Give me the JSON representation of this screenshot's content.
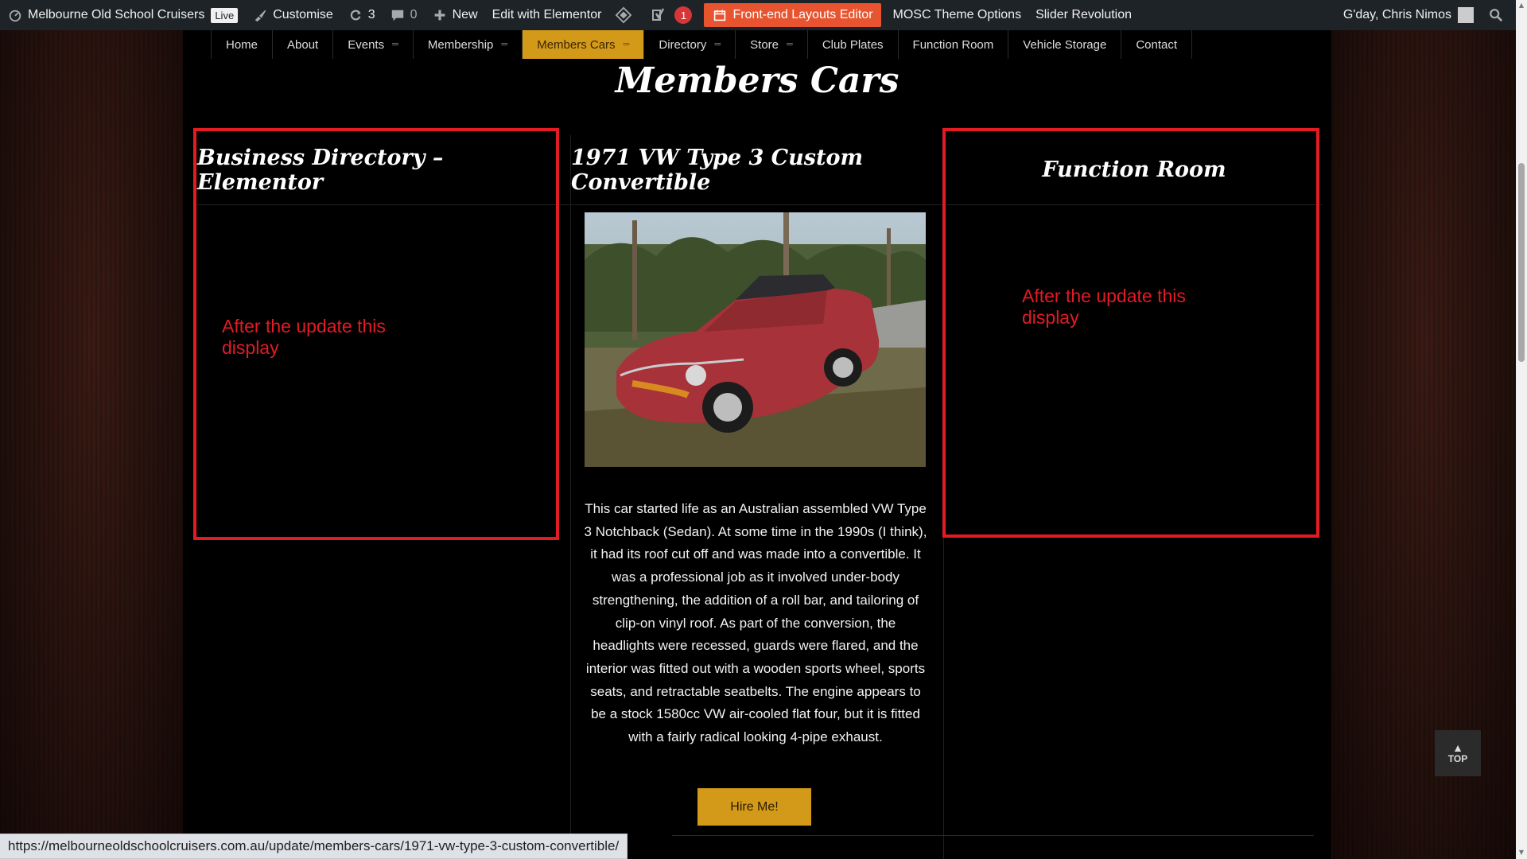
{
  "adminbar": {
    "site_name": "Melbourne Old School Cruisers",
    "live": "Live",
    "customise": "Customise",
    "updates_count": "3",
    "comments_count": "0",
    "new": "New",
    "edit_elementor": "Edit with Elementor",
    "yoast_count": "1",
    "frontend_editor": "Front-end Layouts Editor",
    "theme_options": "MOSC Theme Options",
    "slider_revolution": "Slider Revolution",
    "greeting": "G'day, Chris Nimos"
  },
  "nav": {
    "items": [
      {
        "label": "Home"
      },
      {
        "label": "About"
      },
      {
        "label": "Events"
      },
      {
        "label": "Membership"
      },
      {
        "label": "Members Cars"
      },
      {
        "label": "Directory"
      },
      {
        "label": "Store"
      },
      {
        "label": "Club Plates"
      },
      {
        "label": "Function Room"
      },
      {
        "label": "Vehicle Storage"
      },
      {
        "label": "Contact"
      }
    ]
  },
  "page": {
    "title": "Members Cars"
  },
  "columns": {
    "left_title": "Business Directory – Elementor",
    "center_title": "1971 VW Type 3 Custom Convertible",
    "right_title": "Function Room",
    "note_left": "After the update this display",
    "note_right": "After the update this display",
    "description": "This car started life as an Australian assembled VW Type 3 Notchback (Sedan). At some time in the 1990s (I think), it had its roof cut off and was made into a convertible. It was a professional job as it involved under-body strengthening, the addition of a roll bar, and tailoring of clip-on vinyl roof. As part of the conversion, the headlights were recessed, guards were flared, and the interior was fitted out with a wooden sports wheel, sports seats, and retractable seatbelts. The engine appears to be a stock 1580cc VW air-cooled flat four, but it is fitted with a fairly radical looking 4-pipe exhaust.",
    "hire_button": "Hire Me!"
  },
  "top_button": "TOP",
  "status_url": "https://melbourneoldschoolcruisers.com.au/update/members-cars/1971-vw-type-3-custom-convertible/"
}
